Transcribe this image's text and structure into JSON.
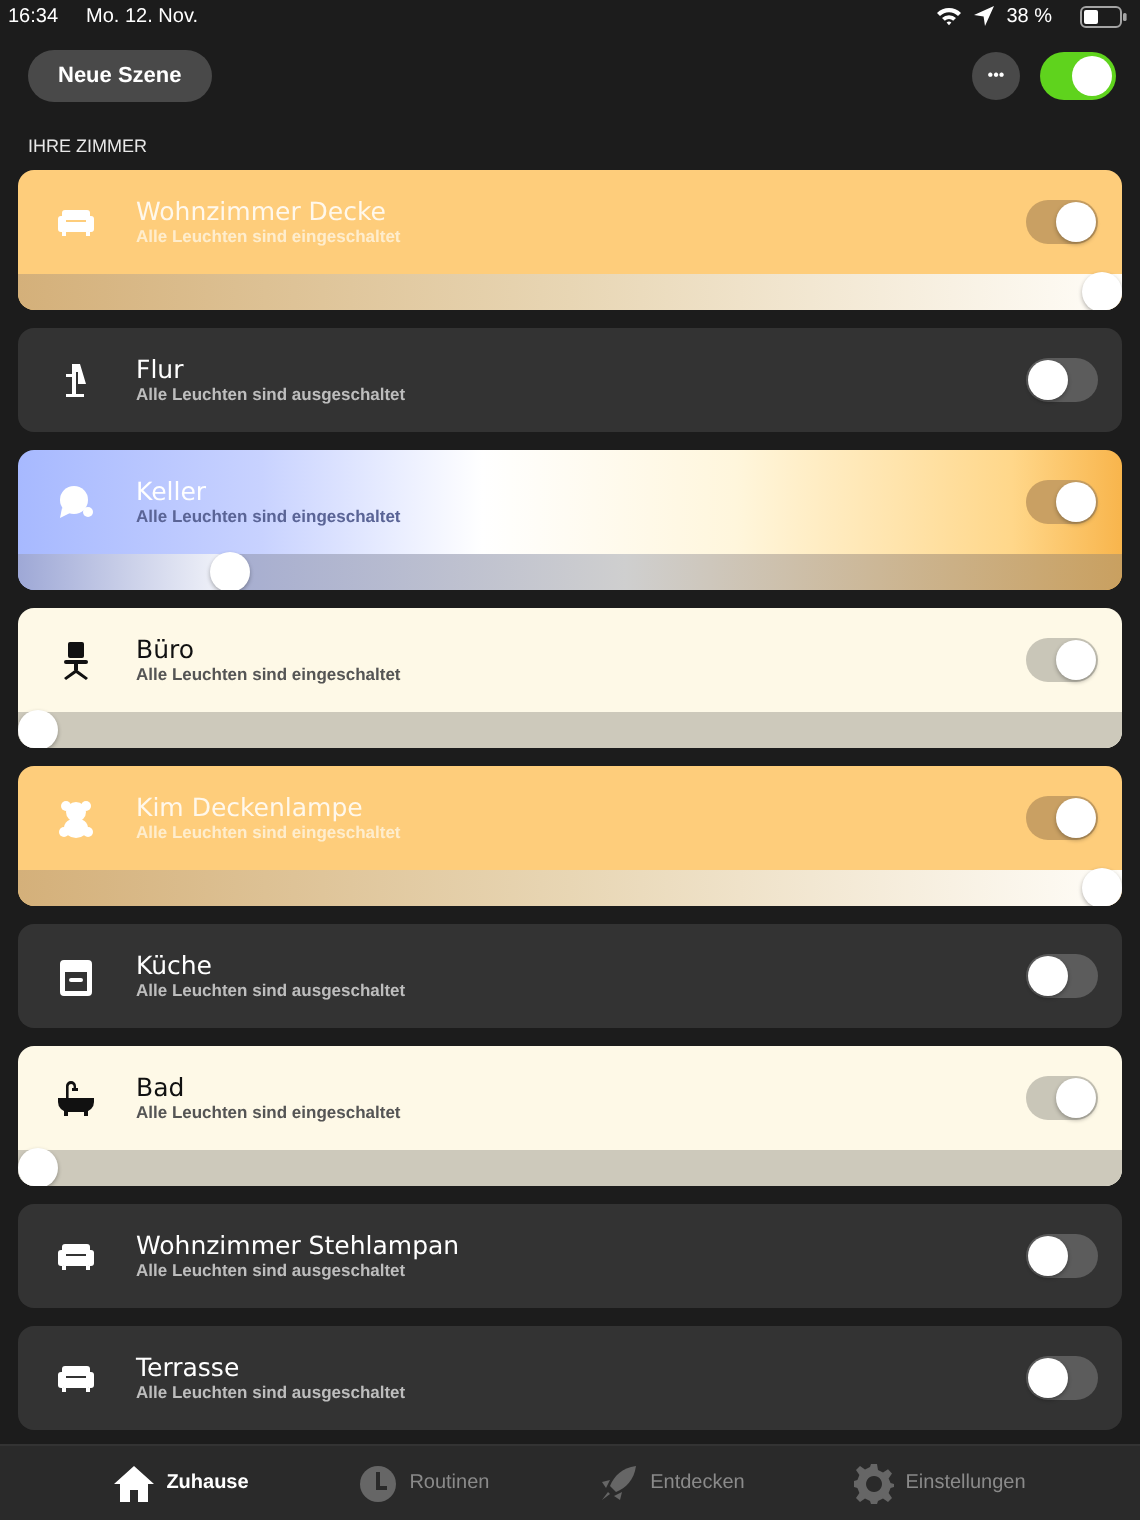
{
  "status_bar": {
    "time": "16:34",
    "date": "Mo. 12. Nov.",
    "battery": "38 %"
  },
  "header": {
    "scene_button": "Neue Szene",
    "more_button": "•••",
    "master_on": true
  },
  "section_title": "IHRE ZIMMER",
  "rooms": [
    {
      "name": "Wohnzimmer Decke",
      "status": "Alle Leuchten sind eingeschaltet",
      "kind": "warm",
      "on": true,
      "level": 1
    },
    {
      "name": "Flur",
      "status": "Alle Leuchten sind ausgeschaltet",
      "kind": "off",
      "on": false
    },
    {
      "name": "Keller",
      "status": "Alle Leuchten sind eingeschaltet",
      "kind": "spectrum",
      "on": true,
      "level": 0.18
    },
    {
      "name": "Büro",
      "status": "Alle Leuchten sind eingeschaltet",
      "kind": "cream",
      "on": true,
      "level": 0
    },
    {
      "name": "Kim Deckenlampe",
      "status": "Alle Leuchten sind eingeschaltet",
      "kind": "warm",
      "on": true,
      "level": 1
    },
    {
      "name": "Küche",
      "status": "Alle Leuchten sind ausgeschaltet",
      "kind": "off",
      "on": false
    },
    {
      "name": "Bad",
      "status": "Alle Leuchten sind eingeschaltet",
      "kind": "cream",
      "on": true,
      "level": 0
    },
    {
      "name": "Wohnzimmer Stehlampan",
      "status": "Alle Leuchten sind ausgeschaltet",
      "kind": "off",
      "on": false
    },
    {
      "name": "Terrasse",
      "status": "Alle Leuchten sind ausgeschaltet",
      "kind": "off",
      "on": false
    }
  ],
  "tabs": [
    {
      "label": "Zuhause",
      "selected": true
    },
    {
      "label": "Routinen",
      "selected": false
    },
    {
      "label": "Entdecken",
      "selected": false
    },
    {
      "label": "Einstellungen",
      "selected": false
    }
  ]
}
